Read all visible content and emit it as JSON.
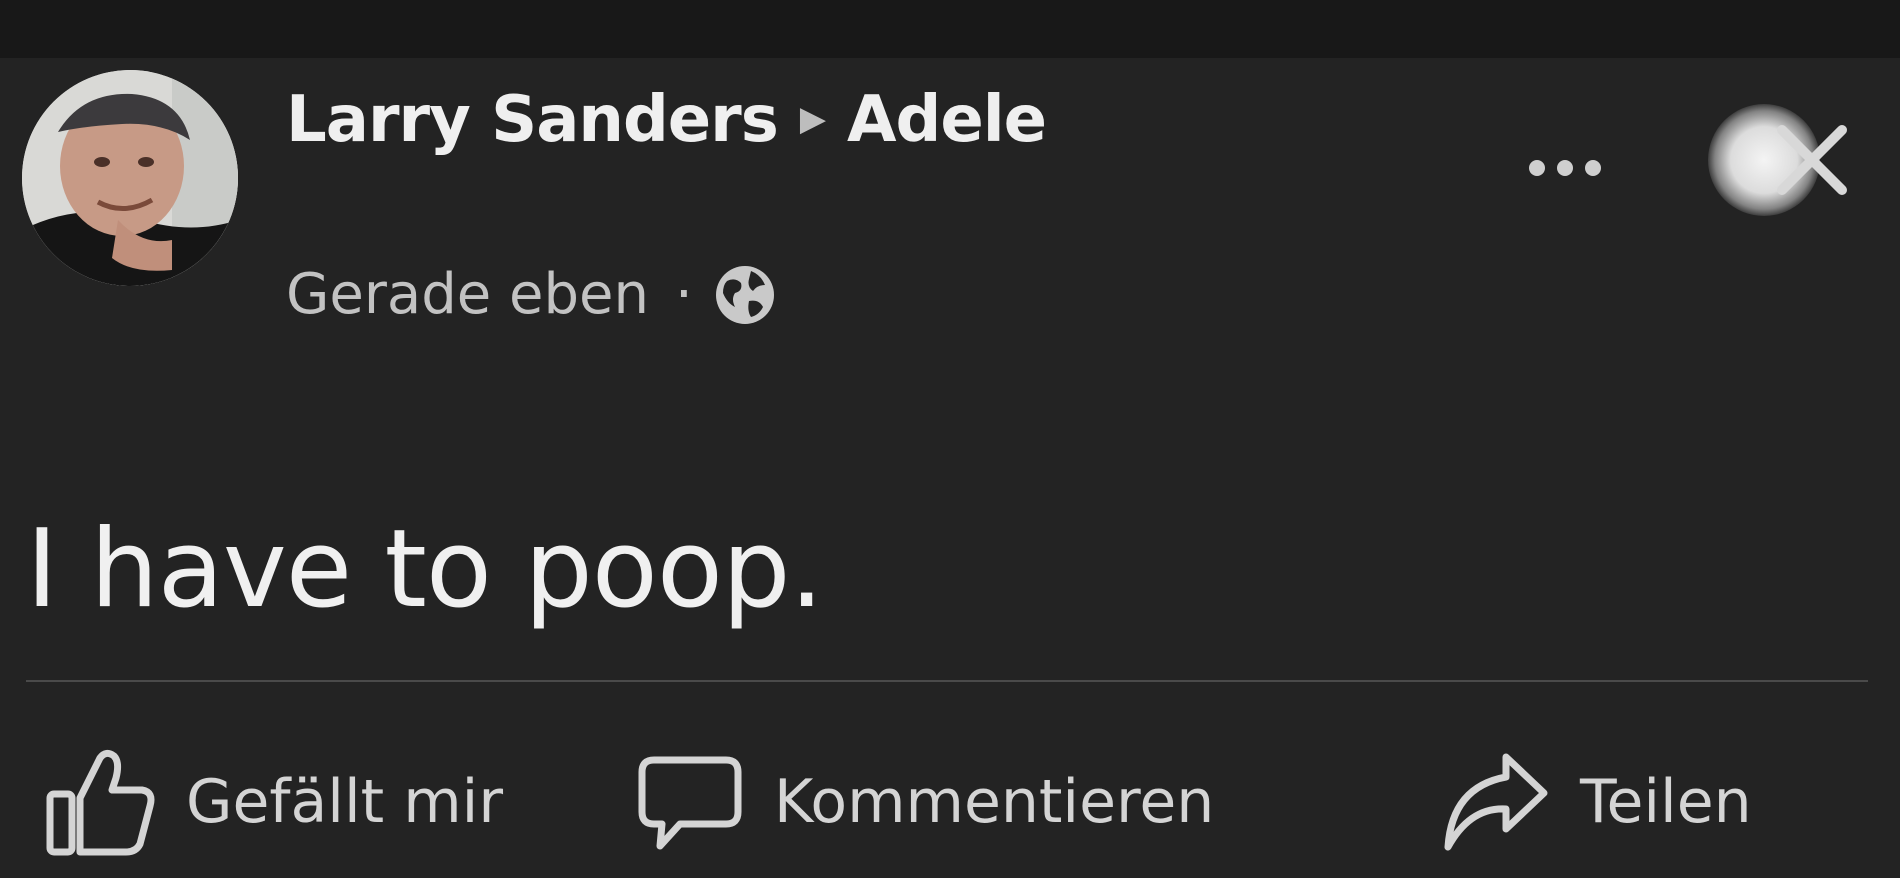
{
  "post": {
    "author": "Larry Sanders",
    "target": "Adele",
    "arrow": "▶",
    "timestamp": "Gerade eben",
    "separator": "·",
    "privacy_icon": "globe-icon",
    "text": "I have to poop."
  },
  "header_actions": {
    "more_icon": "more-horizontal-icon",
    "close_icon": "close-icon"
  },
  "actions": {
    "like": {
      "label": "Gefällt mir",
      "icon": "thumbs-up-icon"
    },
    "comment": {
      "label": "Kommentieren",
      "icon": "comment-icon"
    },
    "share": {
      "label": "Teilen",
      "icon": "share-icon"
    }
  },
  "colors": {
    "background": "#232323",
    "topbar": "#181818",
    "primary_text": "#efefef",
    "secondary_text": "#c2c2c2"
  }
}
